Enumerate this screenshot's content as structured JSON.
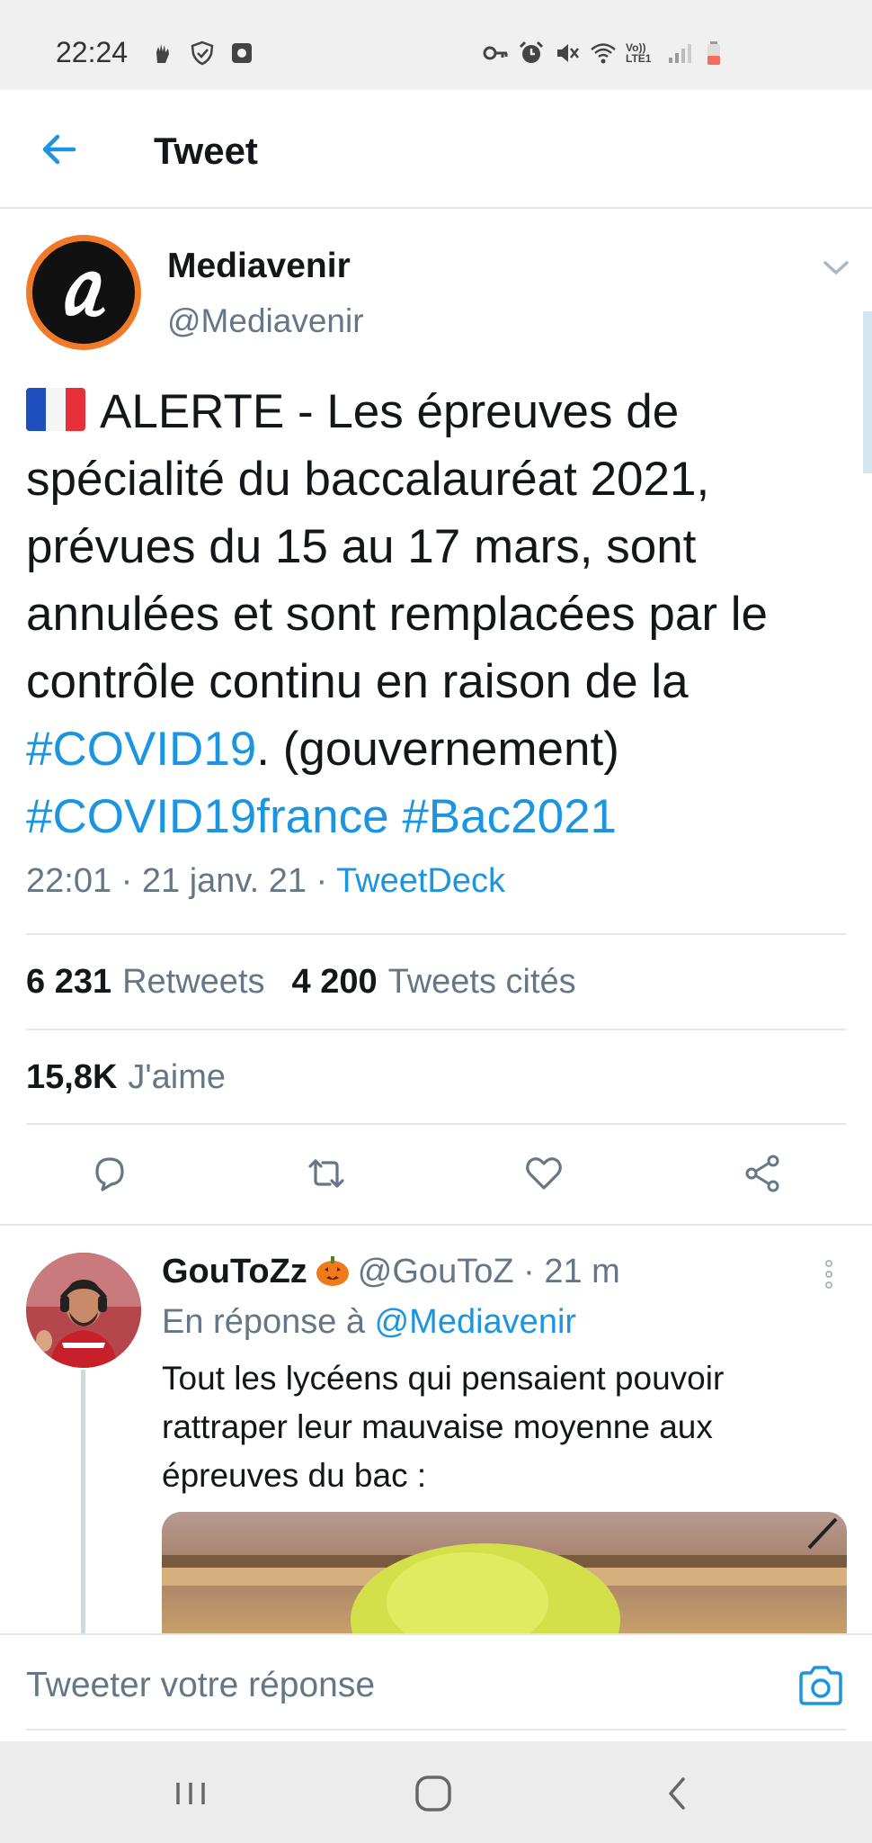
{
  "status_bar": {
    "time": "22:24",
    "left_icons": [
      "hand-icon",
      "shield-check-icon",
      "square-app-icon"
    ],
    "right_icons": [
      "key-icon",
      "alarm-icon",
      "mute-icon",
      "wifi-icon",
      "volte-icon",
      "signal-icon",
      "battery-icon"
    ],
    "volte_label": "Vo)) LTE1"
  },
  "header": {
    "back_icon": "arrow-left-icon",
    "title": "Tweet"
  },
  "tweet": {
    "author_name": "Mediavenir",
    "author_handle": "@Mediavenir",
    "text_part1": "ALERTE - Les épreuves de spécialité du baccalauréat 2021, prévues du 15 au 17 mars, sont annulées et sont remplacées par le contrôle continu en raison de la ",
    "hashtag1": "#COVID19",
    "text_part2": ". (gouvernement) ",
    "hashtag2": "#COVID19france",
    "hashtag3": "#Bac2021",
    "meta_time": "22:01 · 21 janv. 21 · ",
    "meta_source": "TweetDeck",
    "retweets_count": "6 231",
    "retweets_label": "Retweets",
    "quotes_count": "4 200",
    "quotes_label": "Tweets cités",
    "likes_count": "15,8K",
    "likes_label": "J'aime"
  },
  "reply": {
    "name": "GouToZz",
    "handle": "@GouToZ",
    "time": " · 21 m",
    "reply_to_prefix": "En réponse à ",
    "reply_to_handle": "@Mediavenir",
    "text": "Tout les lycéens qui pensaient pouvoir rattraper leur mauvaise moyenne aux épreuves du bac :"
  },
  "compose": {
    "placeholder": "Tweeter votre réponse"
  },
  "colors": {
    "accent": "#1b95e0",
    "secondary_text": "#657786",
    "divider": "#e1e8ed"
  }
}
